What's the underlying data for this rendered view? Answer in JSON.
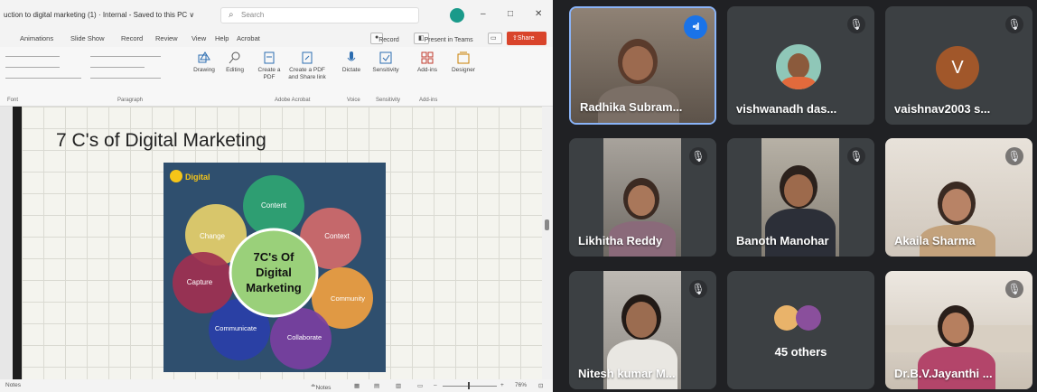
{
  "ppt": {
    "doc_title": "uction to digital marketing (1) · Internal - Saved to this PC ∨",
    "search_placeholder": "Search",
    "window_controls": [
      "–",
      "□",
      "✕"
    ],
    "tabs": [
      "Animations",
      "Slide Show",
      "Record",
      "Review",
      "View",
      "Help",
      "Acrobat"
    ],
    "record_label": "Record",
    "present_label": "Present in Teams",
    "share_label": "Share",
    "ribbon_items": [
      "Drawing",
      "Editing",
      "Create a PDF",
      "Create a PDF and Share link",
      "Dictate",
      "Sensitivity",
      "Add-ins",
      "Designer"
    ],
    "ribbon_groups": [
      "Font",
      "Paragraph",
      "Adobe Acrobat",
      "Voice",
      "Sensitivity",
      "Add-ins"
    ],
    "slide_title": "7 C's of Digital Marketing",
    "slide_image": {
      "logo": "Digital",
      "center_text": [
        "7C's Of",
        "Digital",
        "Marketing"
      ],
      "petals": [
        "Content",
        "Context",
        "Community",
        "Collaborate",
        "Communicate",
        "Capture",
        "Change"
      ],
      "colors": {
        "bg": "#2f4f6e",
        "center": "#9ad07a",
        "content": "#2fa572",
        "context": "#d26a6a",
        "community": "#f0a040",
        "collaborate": "#7a3fa0",
        "communicate": "#2a3fa8",
        "capture": "#a03050",
        "change": "#e7d06a"
      }
    },
    "status_left": "Notes",
    "status_notes": "Notes",
    "zoom": "76%"
  },
  "meet": {
    "tiles": [
      {
        "name": "Radhika Subram...",
        "active": true,
        "muted": false
      },
      {
        "name": "vishwanadh das...",
        "active": false,
        "muted": true
      },
      {
        "name": "vaishnav2003 s...",
        "active": false,
        "muted": true,
        "avatar_letter": "V",
        "avatar_color": "#a1572a"
      },
      {
        "name": "Likhitha Reddy",
        "active": false,
        "muted": true
      },
      {
        "name": "Banoth Manohar",
        "active": false,
        "muted": true
      },
      {
        "name": "Akaila Sharma",
        "active": false,
        "muted": true
      },
      {
        "name": "Nitesh kumar M...",
        "active": false,
        "muted": true
      },
      {
        "name": "45 others",
        "active": false,
        "muted": false
      },
      {
        "name": "Dr.B.V.Jayanthi ...",
        "active": false,
        "muted": true
      }
    ]
  }
}
